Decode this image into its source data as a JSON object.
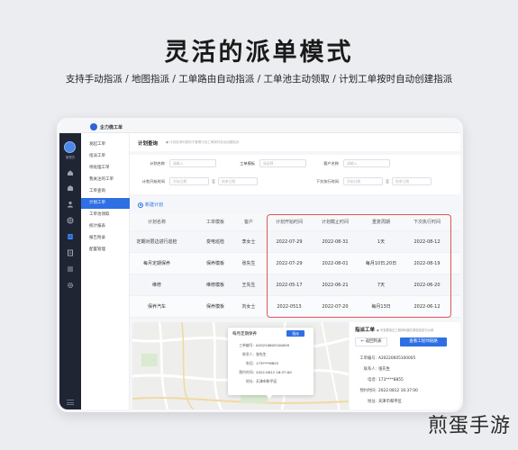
{
  "headline": "灵活的派单模式",
  "subline": "支持手动指派 / 地图指派 / 工单路由自动指派 / 工单池主动领取 / 计划工单按时自动创建指派",
  "app": {
    "logo_text": "企力微工单"
  },
  "rail": {
    "user_name": "管理员",
    "icons": [
      "home-icon",
      "building-icon",
      "people-icon",
      "globe-icon",
      "workorder-icon",
      "document-icon",
      "list-icon",
      "gear-icon"
    ],
    "active_icon": "workorder-icon"
  },
  "submenu": {
    "items": [
      "发起工单",
      "指派工单",
      "待处理工单",
      "我关注的工单",
      "工单查询",
      "计划工单",
      "工单池领取",
      "统计报表",
      "报告附录",
      "配置管理"
    ],
    "active_index": 5
  },
  "page": {
    "title": "计划查询",
    "hint": "● 计划查询列表用于管理计划工单按时自动创建指派"
  },
  "filters": {
    "name_label": "计划名称",
    "name_placeholder": "请输入",
    "template_label": "工单模板",
    "template_placeholder": "请选择",
    "customer_label": "客户名称",
    "customer_placeholder": "请输入",
    "start_label": "计划开始时间",
    "start_from": "开始日期",
    "start_to": "结束日期",
    "next_label": "下次执行时间",
    "next_from": "开始日期",
    "next_to": "结束日期",
    "range_sep": "至"
  },
  "new_plan_label": "新建计划",
  "table": {
    "headers": [
      "计划名称",
      "工单模板",
      "客户",
      "计划开始时间",
      "计划截止时间",
      "重复周期",
      "下次执行时间"
    ],
    "rows": [
      [
        "定期对层边进行巡检",
        "变电巡检",
        "李女士",
        "2022-07-29",
        "2022-08-31",
        "1天",
        "2022-08-12"
      ],
      [
        "每月定期保养",
        "保养模板",
        "张先生",
        "2022-07-29",
        "2022-08-01",
        "每月10日,20日",
        "2022-08-19"
      ],
      [
        "维修",
        "维修模板",
        "王先生",
        "2022-05-17",
        "2022-06-21",
        "7天",
        "2022-06-20"
      ],
      [
        "保养汽车",
        "保养模板",
        "刘女士",
        "2022-0513",
        "2022-07-20",
        "每月13日",
        "2022-06-12"
      ]
    ]
  },
  "map_popup": {
    "title": "每月定期保养",
    "button": "指派",
    "lines": [
      {
        "k": "工单编号:",
        "v": "A20220605100005"
      },
      {
        "k": "联系人:",
        "v": "张先生"
      },
      {
        "k": "电话:",
        "v": "173****8855"
      },
      {
        "k": "预约时间:",
        "v": "2022.0812 16:37:00"
      },
      {
        "k": "地址:",
        "v": "天津市和平区"
      }
    ]
  },
  "detail": {
    "title": "指派工单",
    "hint": "● 可查看各位工程师地图位置信息进行派单",
    "back_button": "← 返回列表",
    "route_button": "查看工程师链路",
    "lines": [
      {
        "k": "工单编号:",
        "v": "A20220605100005"
      },
      {
        "k": "联系人:",
        "v": "张先生"
      },
      {
        "k": "电话:",
        "v": "173****8855"
      },
      {
        "k": "预约时间:",
        "v": "2022.0812 16:37:00"
      },
      {
        "k": "地址:",
        "v": "天津市和平区"
      }
    ]
  },
  "watermark": "煎蛋手游",
  "colors": {
    "accent": "#2f6fe4",
    "highlight": "#e05555",
    "rail": "#1f2533"
  }
}
